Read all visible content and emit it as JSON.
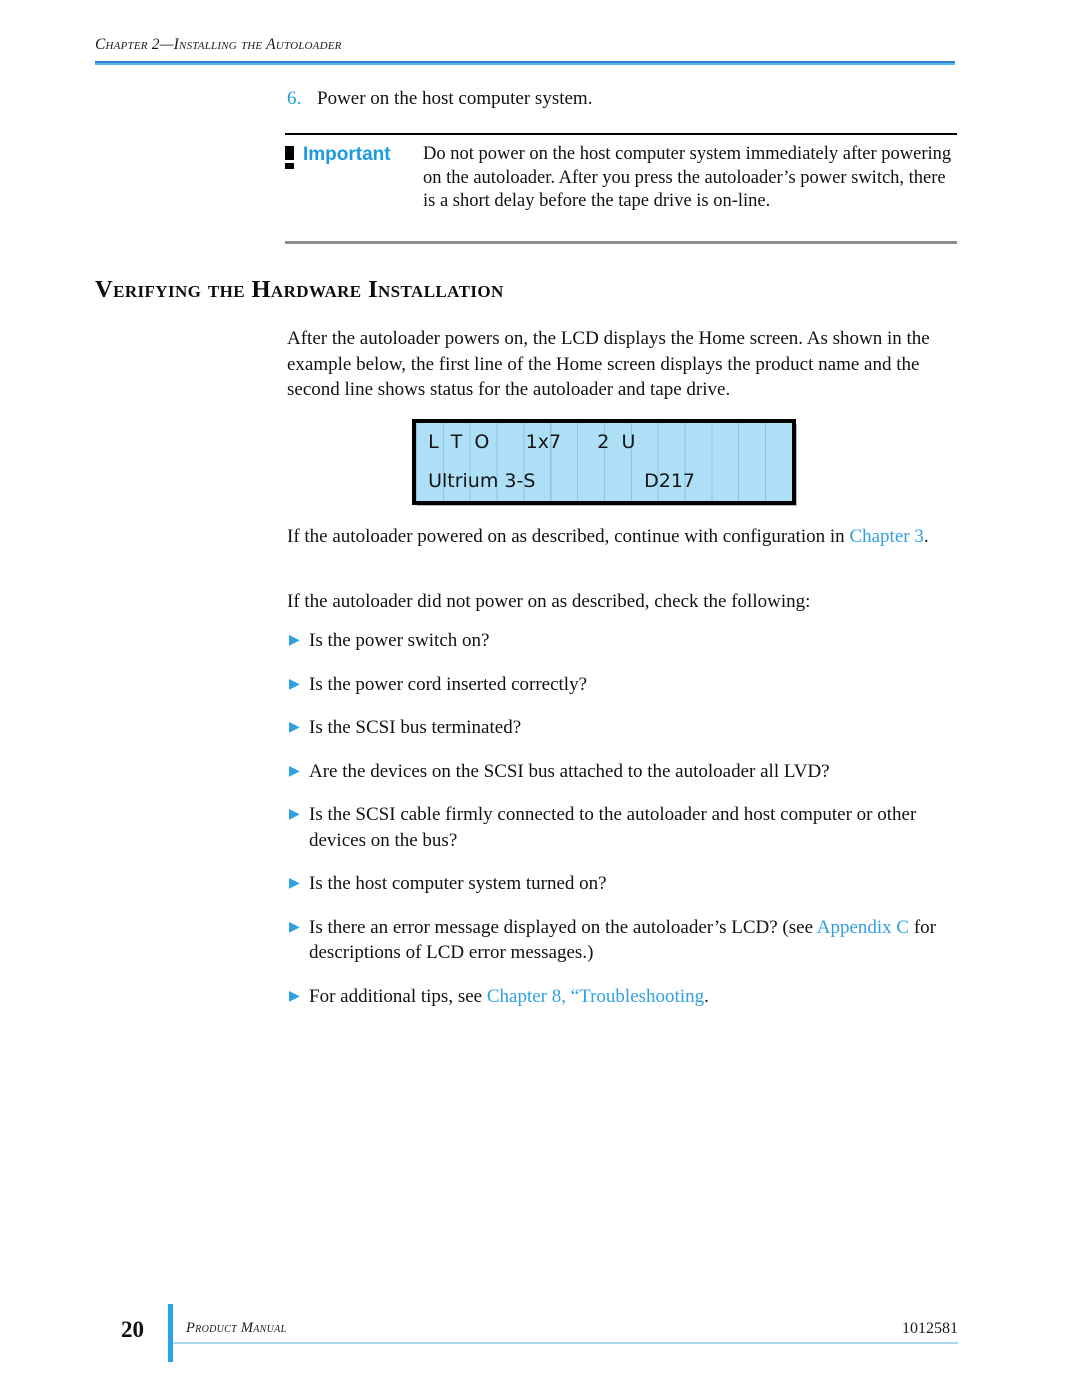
{
  "header": {
    "running_head": "Chapter 2—Installing the Autoloader"
  },
  "step": {
    "number": "6.",
    "text": "Power on the host computer system."
  },
  "callout": {
    "icon": "exclamation-icon",
    "label": "Important",
    "text": "Do not power on the host computer system immediately after powering on the autoloader. After you press the autoloader’s power switch, there is a short delay before the tape drive is on-line."
  },
  "section": {
    "heading": "Verifying the Hardware Installation",
    "intro_paragraph": "After the autoloader powers on, the LCD displays the Home screen. As shown in the example below, the first line of the Home screen displays the product name and the second line shows status for the autoloader and tape drive."
  },
  "lcd": {
    "line1": "  L  T  O      1x7      2  U",
    "line2": "  Ultrium 3-S                  D217",
    "background_color": "#ade0f7",
    "text_color": "#141414",
    "border_color": "#000000"
  },
  "paragraphs": {
    "powered_on_prefix": "If the autoloader powered on as described, continue with configuration in ",
    "powered_on_link": "Chapter 3",
    "powered_on_suffix": ".",
    "not_powered_on": "If the autoloader did not power on as described, check the following:"
  },
  "bullets": [
    {
      "marker": "▶",
      "prefix": "Is the power switch on?",
      "link": "",
      "suffix": ""
    },
    {
      "marker": "▶",
      "prefix": "Is the power cord inserted correctly?",
      "link": "",
      "suffix": ""
    },
    {
      "marker": "▶",
      "prefix": "Is the SCSI bus terminated?",
      "link": "",
      "suffix": ""
    },
    {
      "marker": "▶",
      "prefix": "Are the devices on the SCSI bus attached to the autoloader all LVD?",
      "link": "",
      "suffix": ""
    },
    {
      "marker": "▶",
      "prefix": "Is the SCSI cable firmly connected to the autoloader and host computer or other devices on the bus?",
      "link": "",
      "suffix": ""
    },
    {
      "marker": "▶",
      "prefix": "Is the host computer system turned on?",
      "link": "",
      "suffix": ""
    },
    {
      "marker": "▶",
      "prefix": "Is there an error message displayed on the autoloader’s LCD? (see ",
      "link": "Appendix C",
      "suffix": " for descriptions of LCD error messages.)"
    },
    {
      "marker": "▶",
      "prefix": "For additional tips, see ",
      "link": "Chapter 8, “Troubleshooting",
      "suffix": "."
    }
  ],
  "footer": {
    "page_number": "20",
    "manual_label": "Product Manual",
    "document_number": "1012581",
    "accent_color": "#29a3e8"
  },
  "colors": {
    "link_blue": "#2f9fe0",
    "accent_blue": "#1b9ae0",
    "header_rule_dark": "#2e86d8",
    "header_rule_light": "#59b9ef"
  }
}
